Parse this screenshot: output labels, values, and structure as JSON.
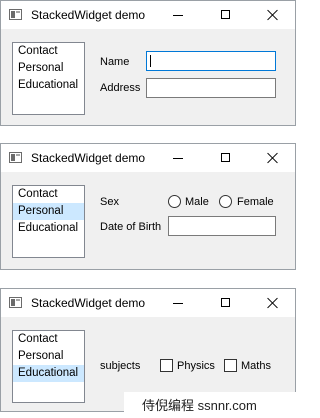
{
  "windows": [
    {
      "title": "StackedWidget demo",
      "list_items": [
        "Contact",
        "Personal",
        "Educational"
      ],
      "selected_index": null,
      "page": {
        "name_label": "Name",
        "address_label": "Address",
        "name_value": "",
        "address_value": ""
      }
    },
    {
      "title": "StackedWidget demo",
      "list_items": [
        "Contact",
        "Personal",
        "Educational"
      ],
      "selected_index": 1,
      "page": {
        "sex_label": "Sex",
        "male_label": "Male",
        "female_label": "Female",
        "dob_label": "Date of Birth",
        "dob_value": ""
      }
    },
    {
      "title": "StackedWidget demo",
      "list_items": [
        "Contact",
        "Personal",
        "Educational"
      ],
      "selected_index": 2,
      "page": {
        "subjects_label": "subjects",
        "physics_label": "Physics",
        "maths_label": "Maths"
      }
    }
  ],
  "watermark": "侍倪编程 ssnnr.com",
  "colors": {
    "selection": "#cce8ff",
    "focus_border": "#0078d7",
    "window_bg": "#f0f0f0"
  },
  "icons": [
    "app-window-icon",
    "minimize-icon",
    "maximize-icon",
    "close-icon"
  ]
}
